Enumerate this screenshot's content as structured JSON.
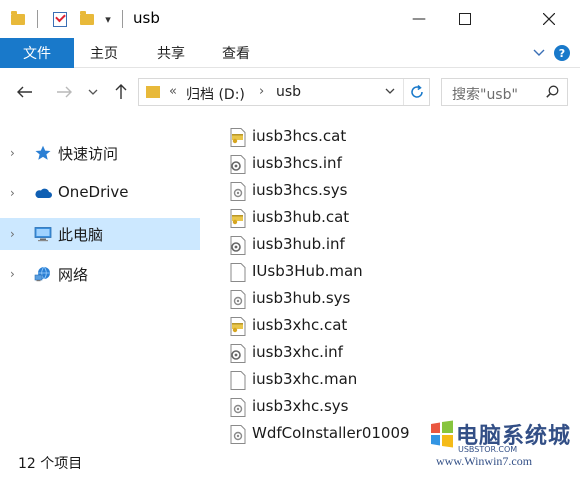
{
  "window": {
    "title": "usb",
    "qa_dropdown": "▾",
    "minimize": "—",
    "maximize": "☐",
    "close": "✕"
  },
  "ribbon": {
    "tabs": [
      "文件",
      "主页",
      "共享",
      "查看"
    ],
    "collapse": "﹀",
    "help": "?"
  },
  "nav": {
    "back": "←",
    "forward": "→",
    "recent": "⌄",
    "up": "↑"
  },
  "address": {
    "overflow": "«",
    "segments": [
      "归档 (D:)",
      "usb"
    ],
    "separator": "›",
    "dropdown": "⌄",
    "refresh": "↻"
  },
  "search": {
    "placeholder": "搜索\"usb\""
  },
  "navigation_pane": {
    "items": [
      {
        "label": "快速访问",
        "icon": "star-icon",
        "selected": false
      },
      {
        "label": "OneDrive",
        "icon": "cloud-icon",
        "selected": false
      },
      {
        "label": "此电脑",
        "icon": "computer-icon",
        "selected": true
      },
      {
        "label": "网络",
        "icon": "network-icon",
        "selected": false
      }
    ],
    "chevron": "›"
  },
  "files": [
    {
      "name": "iusb3hcs.cat",
      "icon": "catalog-file-icon"
    },
    {
      "name": "iusb3hcs.inf",
      "icon": "setup-info-file-icon"
    },
    {
      "name": "iusb3hcs.sys",
      "icon": "system-file-icon"
    },
    {
      "name": "iusb3hub.cat",
      "icon": "catalog-file-icon"
    },
    {
      "name": "iusb3hub.inf",
      "icon": "setup-info-file-icon"
    },
    {
      "name": "IUsb3Hub.man",
      "icon": "blank-file-icon"
    },
    {
      "name": "iusb3hub.sys",
      "icon": "system-file-icon"
    },
    {
      "name": "iusb3xhc.cat",
      "icon": "catalog-file-icon"
    },
    {
      "name": "iusb3xhc.inf",
      "icon": "setup-info-file-icon"
    },
    {
      "name": "iusb3xhc.man",
      "icon": "blank-file-icon"
    },
    {
      "name": "iusb3xhc.sys",
      "icon": "system-file-icon"
    },
    {
      "name": "WdfCoInstaller01009",
      "icon": "system-file-icon"
    }
  ],
  "status": {
    "count_text": "12 个项目"
  },
  "watermark": {
    "main": "电脑系统城",
    "tag": "USBSTOR.COM",
    "sub": "www.Winwin7.com"
  },
  "colors": {
    "accent": "#1979ca",
    "selection": "#cce8ff",
    "folder": "#e8b93a"
  }
}
